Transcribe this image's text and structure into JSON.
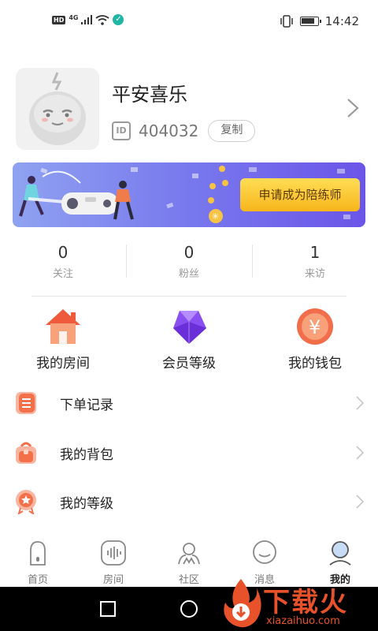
{
  "status_bar": {
    "hd": "HD",
    "network": "4G",
    "time": "14:42"
  },
  "profile": {
    "username": "平安喜乐",
    "id_icon_label": "ID",
    "user_id": "404032",
    "copy_label": "复制"
  },
  "banner": {
    "cta_label": "申请成为陪练师"
  },
  "stats": [
    {
      "value": "0",
      "label": "关注"
    },
    {
      "value": "0",
      "label": "粉丝"
    },
    {
      "value": "1",
      "label": "来访"
    }
  ],
  "features": [
    {
      "label": "我的房间",
      "icon": "house-icon"
    },
    {
      "label": "会员等级",
      "icon": "gem-icon"
    },
    {
      "label": "我的钱包",
      "icon": "yen-coin-icon"
    }
  ],
  "menu": [
    {
      "label": "下单记录",
      "icon": "order-record-icon"
    },
    {
      "label": "我的背包",
      "icon": "backpack-icon"
    },
    {
      "label": "我的等级",
      "icon": "level-badge-icon"
    }
  ],
  "bottom_nav": [
    {
      "label": "首页",
      "icon": "home-icon",
      "active": false
    },
    {
      "label": "房间",
      "icon": "room-icon",
      "active": false
    },
    {
      "label": "社区",
      "icon": "community-icon",
      "active": false
    },
    {
      "label": "消息",
      "icon": "message-icon",
      "active": false
    },
    {
      "label": "我的",
      "icon": "profile-icon",
      "active": true
    }
  ],
  "watermark": {
    "text": "下载火",
    "url": "xiazaihuo.com"
  },
  "colors": {
    "banner_start": "#8fa2f0",
    "banner_end": "#6a55e8",
    "cta": "#f7b51b",
    "accent_orange": "#f2704a"
  }
}
